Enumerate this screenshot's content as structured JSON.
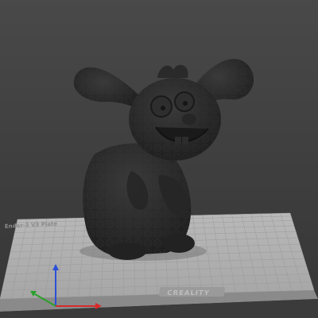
{
  "viewport": {
    "bed": {
      "title": "Ender-3 V3 Plate",
      "brand": "CREALITY"
    },
    "model": {
      "name": "bunny-model"
    }
  }
}
